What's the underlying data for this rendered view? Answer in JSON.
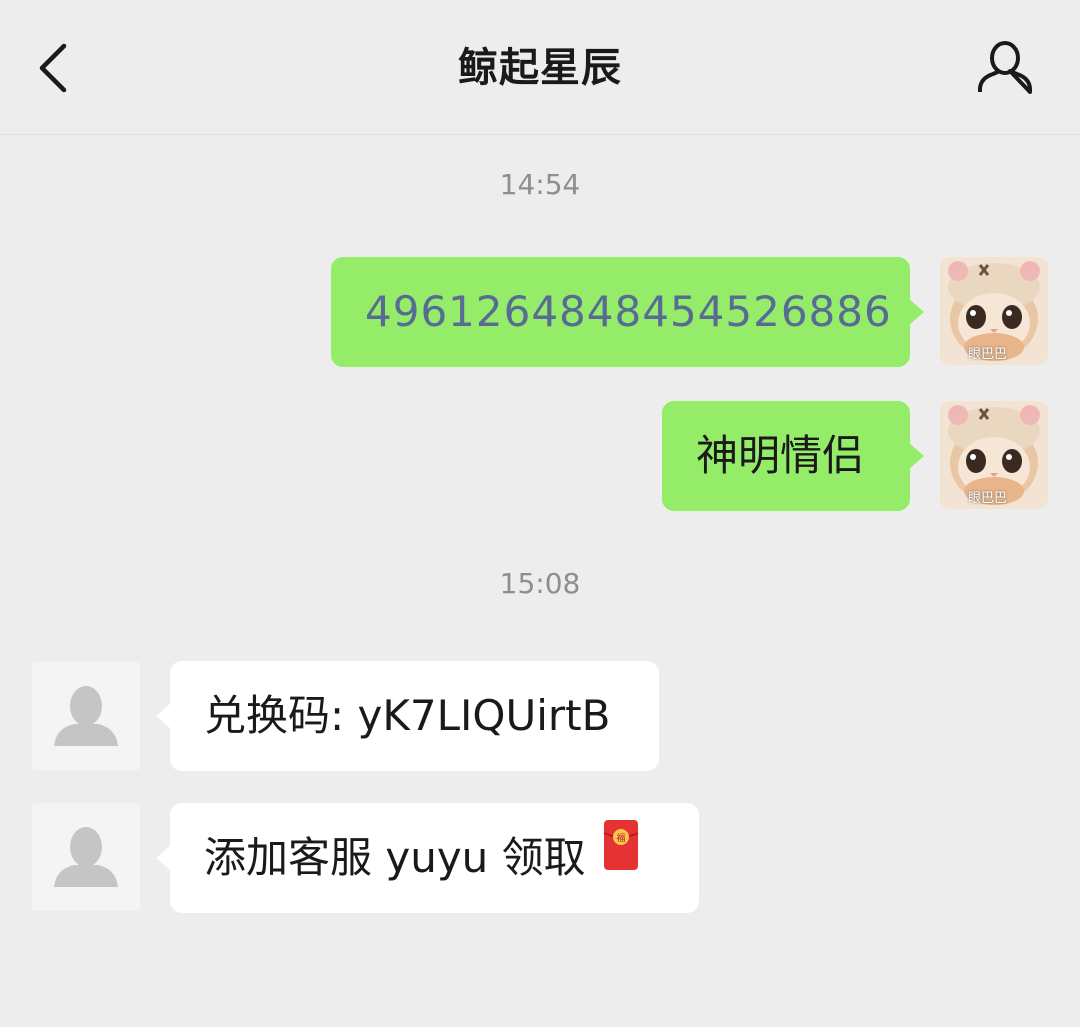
{
  "header": {
    "title": "鲸起星辰",
    "back_icon": "chevron-left-icon",
    "profile_icon": "person-outline-icon"
  },
  "messages": [
    {
      "type": "time",
      "text": "14:54"
    },
    {
      "type": "sent",
      "text": "4961264848454526886",
      "is_link": true,
      "avatar": "cat-avatar",
      "avatar_caption": "眼巴巴"
    },
    {
      "type": "sent",
      "text": "神明情侣",
      "avatar": "cat-avatar",
      "avatar_caption": "眼巴巴"
    },
    {
      "type": "time",
      "text": "15:08"
    },
    {
      "type": "received",
      "text": "兑换码: yK7LIQUirtB",
      "avatar": "default-person-avatar"
    },
    {
      "type": "received",
      "text": "添加客服 yuyu 领取",
      "emoji": "red-envelope-icon",
      "avatar": "default-person-avatar"
    }
  ],
  "colors": {
    "background": "#ededed",
    "sent_bubble": "#95ec69",
    "received_bubble": "#ffffff",
    "link": "#576b95",
    "time": "#8e8e8e"
  }
}
